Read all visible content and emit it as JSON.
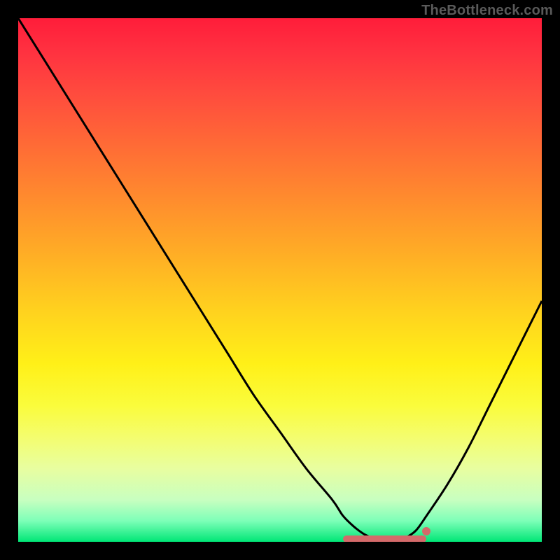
{
  "watermark": "TheBottleneck.com",
  "colors": {
    "curve": "#000000",
    "marker": "#d46a6a",
    "frame": "#000000"
  },
  "chart_data": {
    "type": "line",
    "title": "",
    "xlabel": "",
    "ylabel": "",
    "xlim": [
      0,
      100
    ],
    "ylim": [
      0,
      100
    ],
    "grid": false,
    "legend": false,
    "series": [
      {
        "name": "bottleneck-curve",
        "x": [
          0,
          5,
          10,
          15,
          20,
          25,
          30,
          35,
          40,
          45,
          50,
          55,
          60,
          62,
          64,
          66,
          68,
          70,
          72,
          74,
          76,
          78,
          82,
          86,
          90,
          94,
          98,
          100
        ],
        "y": [
          100,
          92,
          84,
          76,
          68,
          60,
          52,
          44,
          36,
          28,
          21,
          14,
          8,
          5,
          3,
          1.5,
          0.6,
          0.2,
          0.2,
          0.8,
          2.2,
          5,
          11,
          18,
          26,
          34,
          42,
          46
        ]
      }
    ],
    "optimal_range": {
      "x_start": 62,
      "x_end": 78,
      "y": 0.5
    },
    "marker_point": {
      "x": 78,
      "y": 2
    }
  }
}
